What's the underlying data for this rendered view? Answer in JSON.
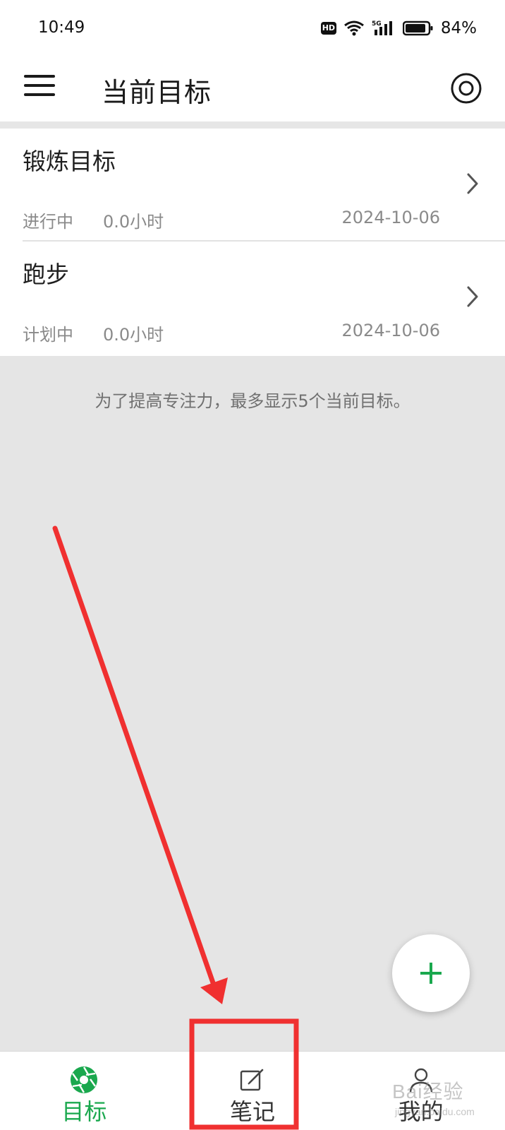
{
  "status_bar": {
    "time": "10:49",
    "hd_label": "HD",
    "network_label": "5G",
    "battery_percent": "84%"
  },
  "header": {
    "title": "当前目标",
    "menu_icon": "hamburger-icon",
    "right_icon": "target-icon"
  },
  "goals": [
    {
      "title": "锻炼目标",
      "status": "进行中",
      "hours": "0.0小时",
      "date": "2024-10-06"
    },
    {
      "title": "跑步",
      "status": "计划中",
      "hours": "0.0小时",
      "date": "2024-10-06"
    }
  ],
  "hint": "为了提高专注力，最多显示5个当前目标。",
  "fab": {
    "icon": "plus-icon",
    "color": "#1aa84e"
  },
  "bottom_nav": {
    "tabs": [
      {
        "label": "目标",
        "icon": "aperture-icon",
        "active": true
      },
      {
        "label": "笔记",
        "icon": "edit-note-icon",
        "active": false
      },
      {
        "label": "我的",
        "icon": "user-icon",
        "active": false
      }
    ]
  },
  "annotation": {
    "arrow_color": "#f03030",
    "highlight_target": "笔记"
  },
  "watermark": {
    "text": "Bai经验",
    "sub": "jingyan.baidu.com"
  },
  "colors": {
    "accent": "#1aa84e",
    "background": "#e5e5e5",
    "surface": "#ffffff"
  }
}
